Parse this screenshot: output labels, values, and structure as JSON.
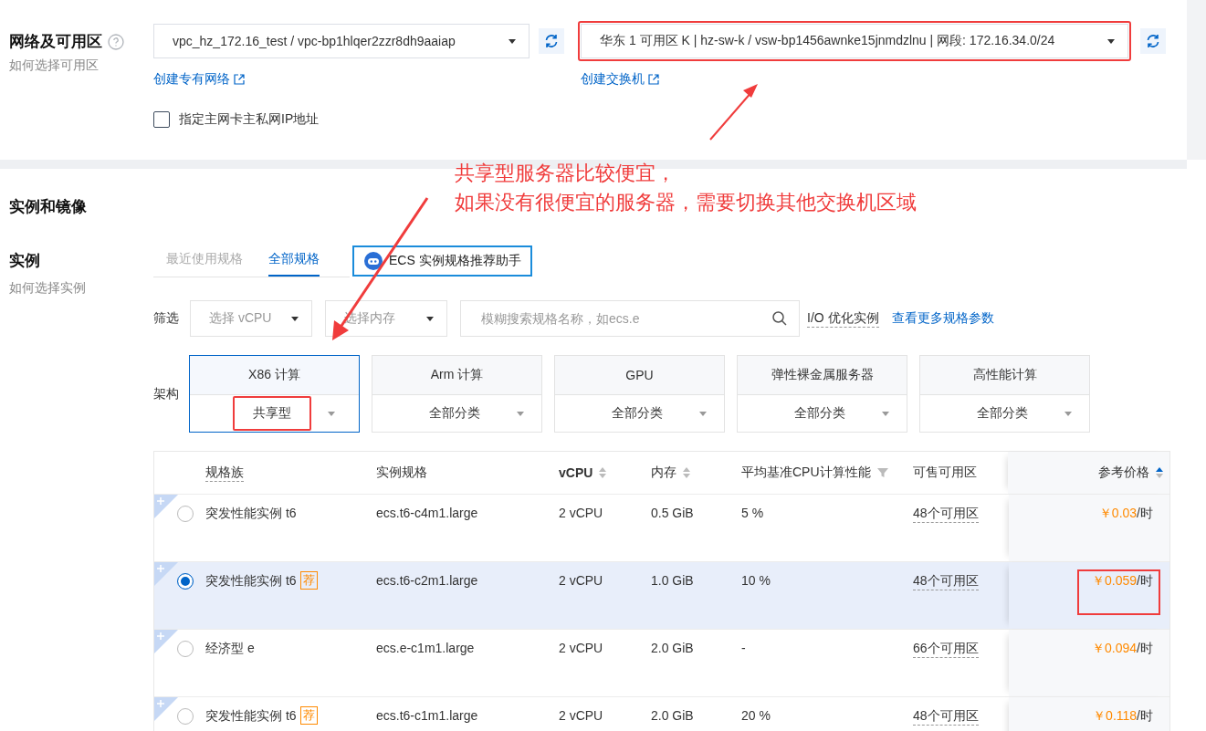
{
  "network": {
    "label": "网络及可用区",
    "hint": "如何选择可用区",
    "vpc_select": "vpc_hz_172.16_test / vpc-bp1hlqer2zzr8dh9aaiap",
    "vpc_link": "创建专有网络",
    "vswitch_select": {
      "value": "华东 1 可用区 K | hz-sw-k / vsw-bp1456awnke15jnmdzlnu | 网段: 172.16.34.0/24",
      "highlighted": true
    },
    "vswitch_link": "创建交换机",
    "ip_checkbox": {
      "label": "指定主网卡主私网IP地址",
      "checked": false
    }
  },
  "instance_section": {
    "title": "实例和镜像"
  },
  "instance": {
    "label": "实例",
    "hint": "如何选择实例",
    "tabs": [
      {
        "label": "最近使用规格",
        "selected": false
      },
      {
        "label": "全部规格",
        "selected": true
      }
    ],
    "assistant_button": "ECS 实例规格推荐助手",
    "filter": {
      "label": "筛选",
      "vcpu_placeholder": "选择 vCPU",
      "memory_placeholder": "选择内存",
      "search_placeholder": "模糊搜索规格名称，如ecs.e",
      "io_label": "I/O 优化实例",
      "more_link": "查看更多规格参数"
    },
    "architecture": {
      "label": "架构",
      "options": [
        {
          "name": "X86 计算",
          "category": "共享型",
          "selected": true,
          "highlighted": true
        },
        {
          "name": "Arm 计算",
          "category": "全部分类",
          "selected": false,
          "highlighted": false
        },
        {
          "name": "GPU",
          "category": "全部分类",
          "selected": false,
          "highlighted": false
        },
        {
          "name": "弹性裸金属服务器",
          "category": "全部分类",
          "selected": false,
          "highlighted": false
        },
        {
          "name": "高性能计算",
          "category": "全部分类",
          "selected": false,
          "highlighted": false
        }
      ]
    },
    "table": {
      "columns": [
        {
          "label": "规格族",
          "kind": "dashed"
        },
        {
          "label": "实例规格",
          "kind": "plain"
        },
        {
          "label": "vCPU",
          "kind": "sort"
        },
        {
          "label": "内存",
          "kind": "sort"
        },
        {
          "label": "平均基准CPU计算性能",
          "kind": "filter"
        },
        {
          "label": "可售可用区",
          "kind": "plain"
        },
        {
          "label": "参考价格",
          "kind": "sorted_asc"
        }
      ],
      "rows": [
        {
          "family": "突发性能实例 t6",
          "recommended": false,
          "spec": "ecs.t6-c4m1.large",
          "vcpu": "2 vCPU",
          "memory": "0.5 GiB",
          "performance": "5 %",
          "zones": "48个可用区",
          "price": "￥0.03",
          "unit": "/时",
          "selected": false,
          "highlighted": false
        },
        {
          "family": "突发性能实例 t6",
          "recommended": true,
          "badge": "荐",
          "spec": "ecs.t6-c2m1.large",
          "vcpu": "2 vCPU",
          "memory": "1.0 GiB",
          "performance": "10 %",
          "zones": "48个可用区",
          "price": "￥0.059",
          "unit": "/时",
          "selected": true,
          "highlighted": true
        },
        {
          "family": "经济型 e",
          "recommended": false,
          "spec": "ecs.e-c1m1.large",
          "vcpu": "2 vCPU",
          "memory": "2.0 GiB",
          "performance": "-",
          "zones": "66个可用区",
          "price": "￥0.094",
          "unit": "/时",
          "selected": false,
          "highlighted": false
        },
        {
          "family": "突发性能实例 t6",
          "recommended": true,
          "badge": "荐",
          "spec": "ecs.t6-c1m1.large",
          "vcpu": "2 vCPU",
          "memory": "2.0 GiB",
          "performance": "20 %",
          "zones": "48个可用区",
          "price": "￥0.118",
          "unit": "/时",
          "selected": false,
          "highlighted": false
        }
      ]
    }
  },
  "annotation": {
    "lines": [
      "共享型服务器比较便宜，",
      "如果没有很便宜的服务器，需要切换其他交换机区域"
    ]
  }
}
